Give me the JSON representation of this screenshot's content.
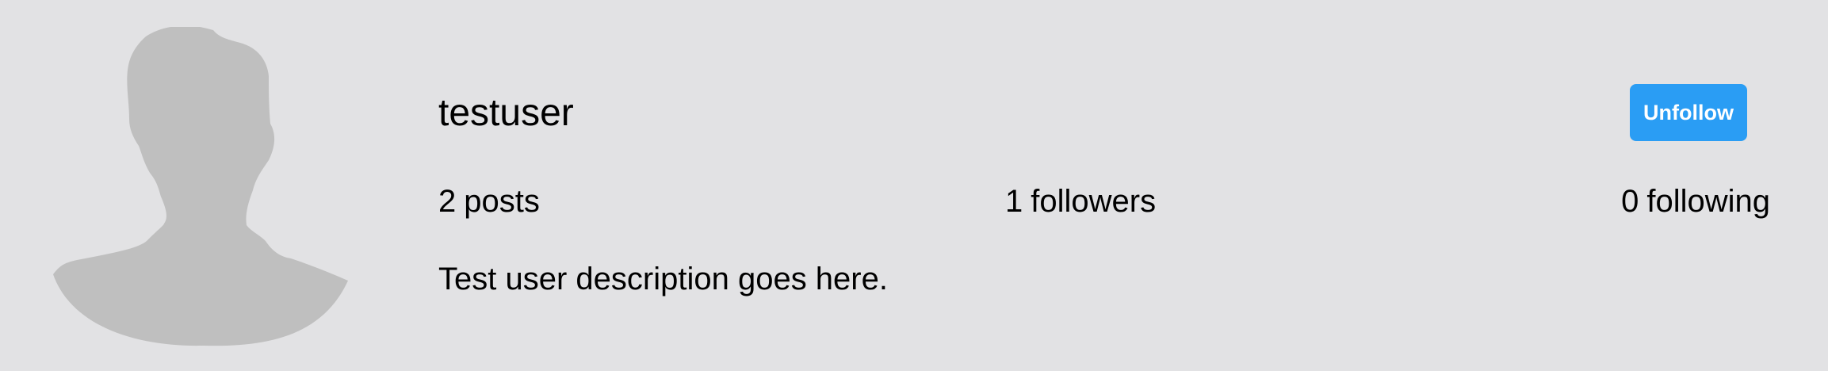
{
  "profile": {
    "avatar_icon": "default-user-silhouette-icon",
    "username": "testuser",
    "follow_button_label": "Unfollow",
    "stats": {
      "posts": {
        "count": "2",
        "label": "posts"
      },
      "followers": {
        "count": "1",
        "label": "followers"
      },
      "following": {
        "count": "0",
        "label": "following"
      }
    },
    "bio": "Test user description goes here."
  },
  "colors": {
    "background": "#e2e2e4",
    "avatar_silhouette": "#bfbfbf",
    "button": "#2a9df4",
    "button_text": "#ffffff",
    "text": "#000000"
  }
}
